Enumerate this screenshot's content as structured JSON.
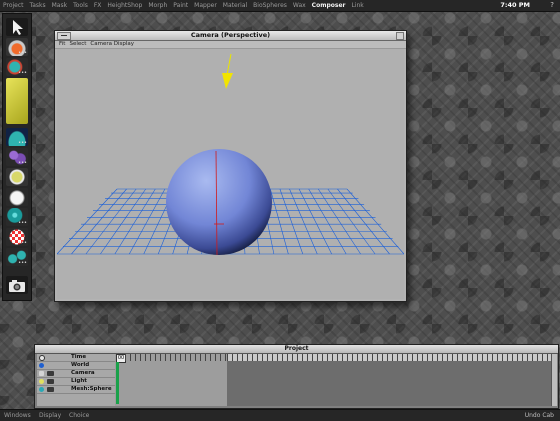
{
  "menubar": {
    "items": [
      "Project",
      "Tasks",
      "Mask",
      "Tools",
      "FX",
      "HeightShop",
      "Morph",
      "Paint",
      "Mapper",
      "Material",
      "BioSpheres",
      "Wax",
      "Composer",
      "Link"
    ],
    "active_index": 12,
    "clock": "7:40 PM",
    "help": "?"
  },
  "camera_window": {
    "title": "Camera  (Perspective)",
    "menu": [
      "Fit",
      "Select",
      "Camera Display"
    ],
    "colors": {
      "viewport_bg": "#b0b0b0",
      "sphere": "#7f95d9",
      "grid": "#1b5fd8",
      "axis_red": "#d11a1a",
      "light_arrow": "#f2e400"
    }
  },
  "project_panel": {
    "title": "Project",
    "rows": [
      {
        "label": "Time",
        "icon_color": "#e6e6e6"
      },
      {
        "label": "World",
        "icon_color": "#1e5fd0"
      },
      {
        "label": "Camera",
        "icon_color": "#d5d5d5"
      },
      {
        "label": "Light",
        "icon_color": "#e0e060"
      },
      {
        "label": "Mesh:Sphere",
        "icon_color": "#2aa9b5"
      }
    ],
    "time_value": "00"
  },
  "bottombar": {
    "items": [
      "Windows",
      "Display",
      "Choice"
    ],
    "right_label": "Undo Cab"
  },
  "palette": {
    "tools": [
      "pointer",
      "saucer",
      "teal-blob",
      "yellow-tile",
      "teal-mound",
      "purple-cluster",
      "white-sphere",
      "teal-sphere",
      "red-checker",
      "teal-cluster",
      "camera"
    ]
  }
}
